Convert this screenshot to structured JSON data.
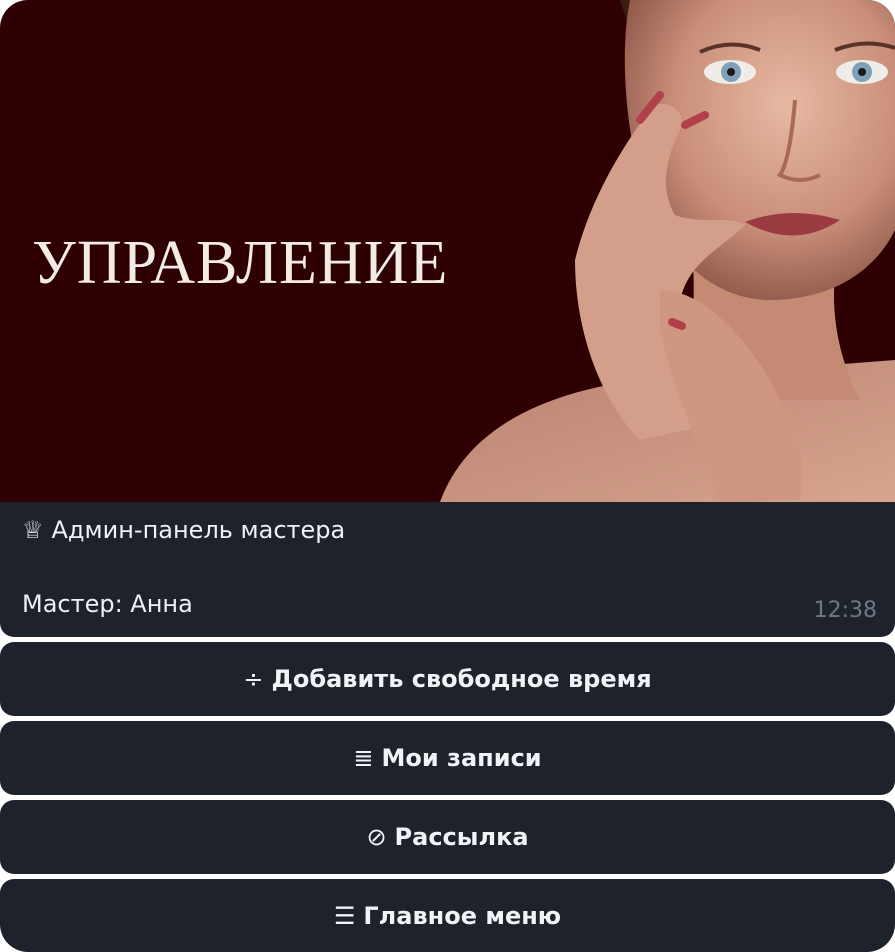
{
  "banner": {
    "title": "УПРАВЛЕНИЕ",
    "background_color": "#2e0004"
  },
  "message": {
    "header_icon": "crown-icon",
    "header_glyph": "♕",
    "header_text": "Админ-панель мастера",
    "master_text": "Мастер: Анна",
    "time": "12:38"
  },
  "keyboard": {
    "buttons": [
      {
        "icon": "add-icon",
        "glyph": "÷",
        "label": "Добавить свободное время"
      },
      {
        "icon": "list-icon",
        "glyph": "≣",
        "label": "Мои записи"
      },
      {
        "icon": "broadcast-icon",
        "glyph": "⊘",
        "label": "Рассылка"
      },
      {
        "icon": "menu-icon",
        "glyph": "☰",
        "label": "Главное меню"
      }
    ]
  },
  "colors": {
    "bubble": "#1e232b",
    "text": "#eef1f5",
    "time": "#6f7883"
  }
}
